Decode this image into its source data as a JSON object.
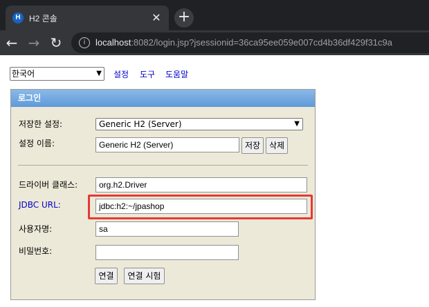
{
  "browser": {
    "tab_title": "H2 콘솔",
    "favicon_text": "H",
    "close_glyph": "✕",
    "newtab_glyph": "+",
    "url_host": "localhost",
    "url_rest": ":8082/login.jsp?jsessionid=36ca95ee059e007cd4b36df429f31c9a"
  },
  "toolbar": {
    "language_value": "한국어",
    "links": [
      "설정",
      "도구",
      "도움말"
    ]
  },
  "login": {
    "header": "로그인",
    "saved_settings_label": "저장한 설정:",
    "saved_settings_value": "Generic H2 (Server)",
    "setting_name_label": "설정 이름:",
    "setting_name_value": "Generic H2 (Server)",
    "save_button": "저장",
    "delete_button": "삭제",
    "driver_class_label": "드라이버 클래스:",
    "driver_class_value": "org.h2.Driver",
    "jdbc_url_label": "JDBC URL:",
    "jdbc_url_value": "jdbc:h2:~/jpashop",
    "username_label": "사용자명:",
    "username_value": "sa",
    "password_label": "비밀번호:",
    "password_value": "",
    "connect_button": "연결",
    "test_button": "연결 시험"
  },
  "colors": {
    "highlight": "#e53935",
    "header_blue": "#5f9ad9",
    "panel_bg": "#ece9d8"
  }
}
